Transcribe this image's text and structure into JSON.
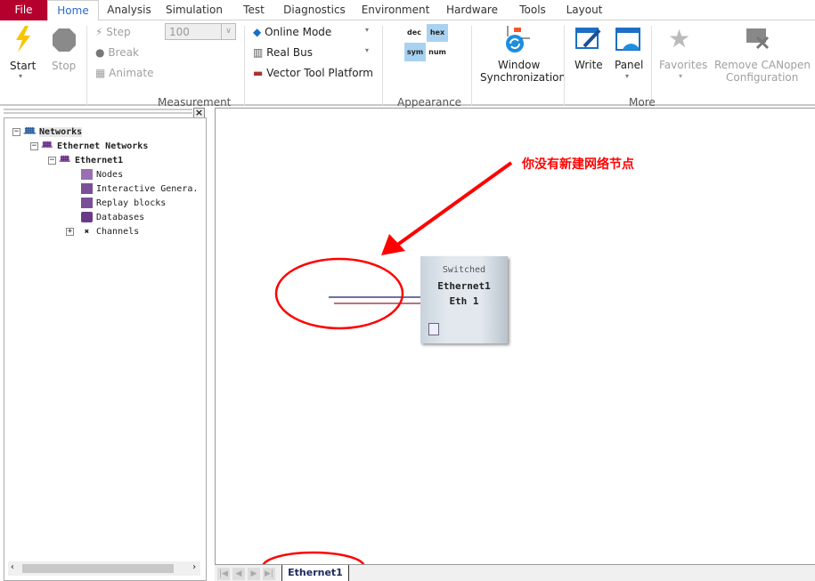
{
  "menu": {
    "tabs": [
      "File",
      "Home",
      "Analysis",
      "Simulation",
      "Test",
      "Diagnostics",
      "Environment",
      "Hardware",
      "Tools",
      "Layout"
    ],
    "active": "Home"
  },
  "ribbon": {
    "start": "Start",
    "stop": "Stop",
    "step": "Step",
    "break": "Break",
    "animate": "Animate",
    "speed_value": "100",
    "online_mode": "Online Mode",
    "real_bus": "Real Bus",
    "vector_tool_platform": "Vector Tool Platform",
    "measurement_group": "Measurement",
    "dec": "dec",
    "hex": "hex",
    "sym": "sym",
    "num": "num",
    "appearance_group": "Appearance",
    "window_sync_1": "Window",
    "window_sync_2": "Synchronization",
    "write": "Write",
    "panel": "Panel",
    "favorites": "Favorites",
    "remove_canopen_1": "Remove CANopen",
    "remove_canopen_2": "Configuration",
    "more_group": "More"
  },
  "tree": {
    "close": "×",
    "items": [
      "Networks",
      "Ethernet Networks",
      "Ethernet1",
      "Nodes",
      "Interactive Genera.",
      "Replay blocks",
      "Databases",
      "Channels"
    ]
  },
  "canvas": {
    "node": {
      "line1": "Switched",
      "line2": "Ethernet1",
      "line3": "Eth 1"
    },
    "annotation": "你没有新建网络节点",
    "annotation_color": "#ff0000"
  },
  "bottom": {
    "tab": "Ethernet1"
  }
}
